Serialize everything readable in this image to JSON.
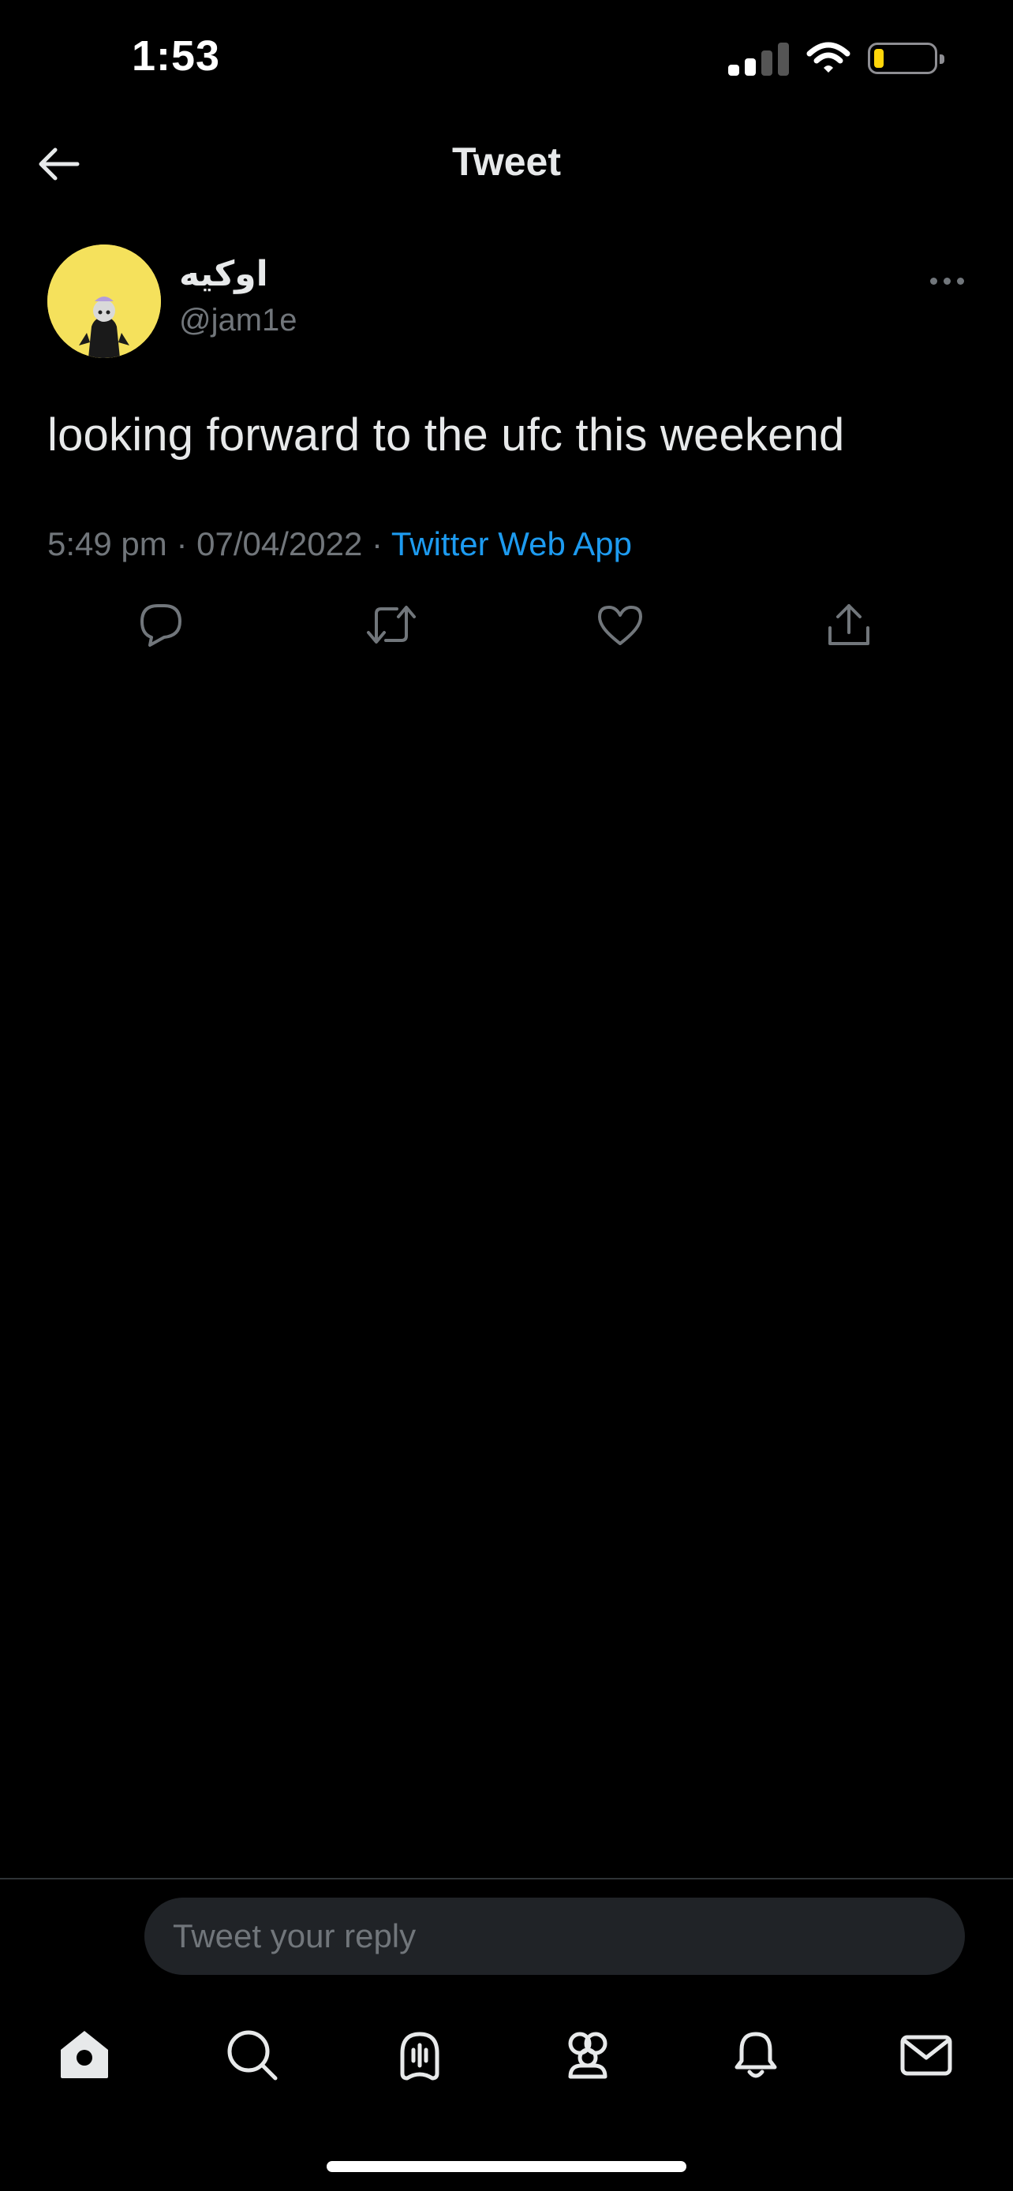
{
  "status_bar": {
    "time": "1:53",
    "icons": [
      "cellular-signal-icon",
      "wifi-icon",
      "battery-low-icon"
    ],
    "battery_color": "#ffd60a"
  },
  "header": {
    "title": "Tweet",
    "back_icon": "arrow-left-icon"
  },
  "tweet": {
    "author": {
      "display_name": "اوكيه",
      "handle": "@jam1e",
      "avatar_color": "#f5e15c"
    },
    "text": "looking forward to the ufc this weekend",
    "time": "5:49 pm",
    "date": "07/04/2022",
    "separator": "·",
    "source": "Twitter Web App",
    "more_icon": "more-horizontal-icon",
    "actions": [
      {
        "name": "reply",
        "icon": "reply-icon"
      },
      {
        "name": "retweet",
        "icon": "retweet-icon"
      },
      {
        "name": "like",
        "icon": "heart-icon"
      },
      {
        "name": "share",
        "icon": "share-icon"
      }
    ]
  },
  "reply_bar": {
    "placeholder": "Tweet your reply"
  },
  "bottom_nav": [
    {
      "name": "home",
      "icon": "home-icon",
      "active": true
    },
    {
      "name": "search",
      "icon": "search-icon"
    },
    {
      "name": "spaces",
      "icon": "spaces-icon"
    },
    {
      "name": "communities",
      "icon": "communities-icon"
    },
    {
      "name": "notifications",
      "icon": "bell-icon"
    },
    {
      "name": "messages",
      "icon": "mail-icon"
    }
  ],
  "colors": {
    "background": "#000000",
    "text_primary": "#e7e9ea",
    "text_secondary": "#71767b",
    "accent": "#1d9bf0",
    "input_background": "#202327"
  }
}
